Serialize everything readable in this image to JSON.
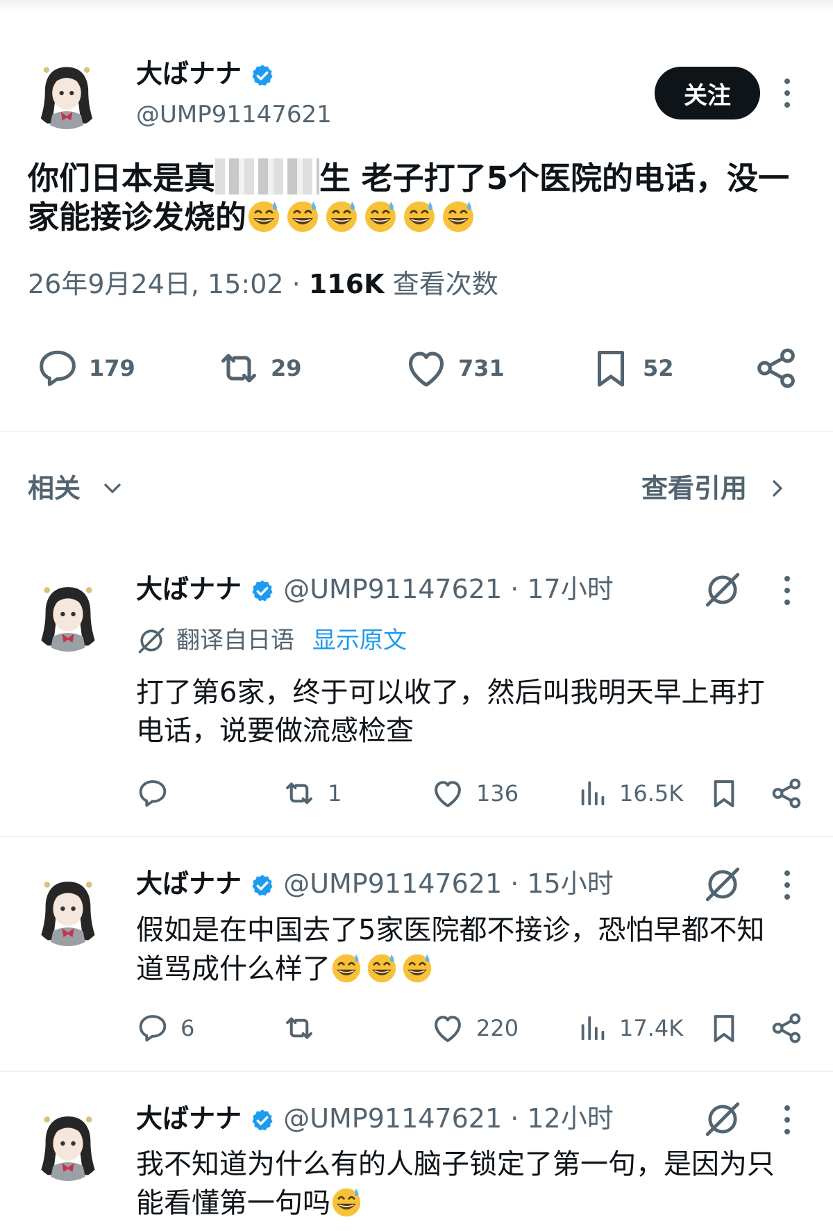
{
  "main_post": {
    "author_name": "大ばナナ",
    "handle": "@UMP91147621",
    "follow_label": "关注",
    "text_part1": "你们日本是真",
    "text_part2": "生 老子打了5个医院的电话，没一",
    "text_line2": "家能接诊发烧的",
    "emoji_count": 6,
    "timestamp": "26年9月24日, 15:02",
    "separator": "·",
    "views": "116K",
    "views_label": "查看次数",
    "replies": "179",
    "reposts": "29",
    "likes": "731",
    "bookmarks": "52"
  },
  "related_bar": {
    "label": "相关",
    "quotes_label": "查看引用"
  },
  "replies": [
    {
      "author_name": "大ばナナ",
      "handle_time": "@UMP91147621 · 17小时",
      "translated_from": "翻译自日语",
      "show_original": "显示原文",
      "line1": "打了第6家，终于可以收了，然后叫我明天早上再打",
      "line2": "电话，说要做流感检查",
      "replies": "",
      "reposts": "1",
      "likes": "136",
      "views": "16.5K"
    },
    {
      "author_name": "大ばナナ",
      "handle_time": "@UMP91147621 · 15小时",
      "line1": "假如是在中国去了5家医院都不接诊，恐怕早都不知",
      "line2": "道骂成什么样了",
      "emoji_count": 3,
      "replies": "6",
      "reposts": "",
      "likes": "220",
      "views": "17.4K"
    },
    {
      "author_name": "大ばナナ",
      "handle_time": "@UMP91147621 · 12小时",
      "line1": "我不知道为什么有的人脑子锁定了第一句，是因为只",
      "line2": "能看懂第一句吗",
      "emoji_count": 1
    }
  ],
  "colors": {
    "accent_blue": "#1d9bf0",
    "text": "#0f1419",
    "muted": "#536471"
  },
  "icons": [
    "verified-badge-icon",
    "reply-icon",
    "repost-icon",
    "like-icon",
    "bookmark-icon",
    "share-icon",
    "views-icon",
    "grok-icon",
    "kebab-icon",
    "chevron-down-icon",
    "chevron-right-icon",
    "sweat-smile-emoji"
  ]
}
